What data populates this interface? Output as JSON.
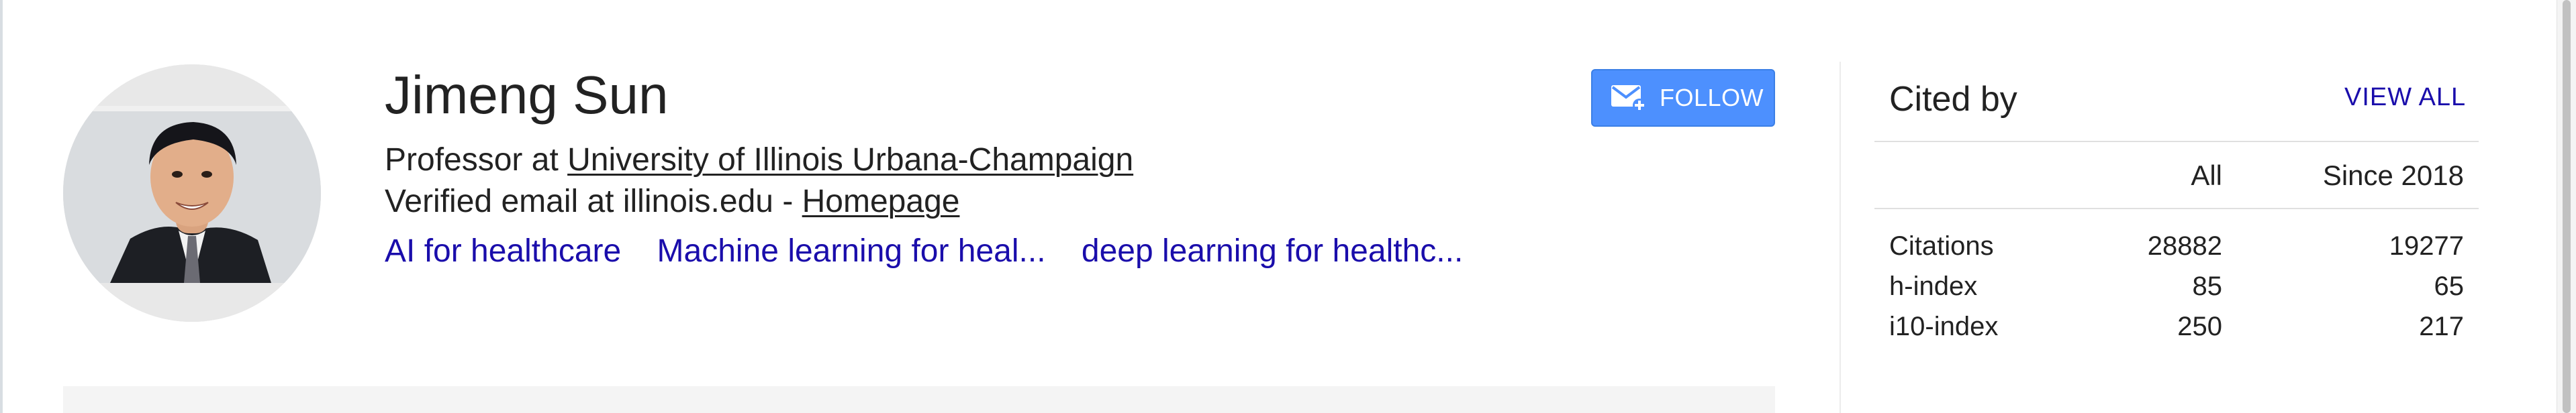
{
  "profile": {
    "name": "Jimeng Sun",
    "affiliation_prefix": "Professor at ",
    "affiliation_link": "University of Illinois Urbana-Champaign",
    "email_prefix": "Verified email at illinois.edu - ",
    "homepage_link": "Homepage",
    "interests": [
      {
        "label": "AI for healthcare"
      },
      {
        "label": "Machine learning for heal..."
      },
      {
        "label": "deep learning for healthc..."
      }
    ]
  },
  "follow": {
    "label": "FOLLOW",
    "icon": "mail-plus-icon"
  },
  "cited_by": {
    "title": "Cited by",
    "view_all": "VIEW ALL",
    "columns": [
      "All",
      "Since 2018"
    ],
    "rows": [
      {
        "label": "Citations",
        "all": "28882",
        "since": "19277"
      },
      {
        "label": "h-index",
        "all": "85",
        "since": "65"
      },
      {
        "label": "i10-index",
        "all": "250",
        "since": "217"
      }
    ]
  },
  "colors": {
    "accent": "#4d90fe",
    "link": "#1a0dab",
    "text": "#222222"
  }
}
